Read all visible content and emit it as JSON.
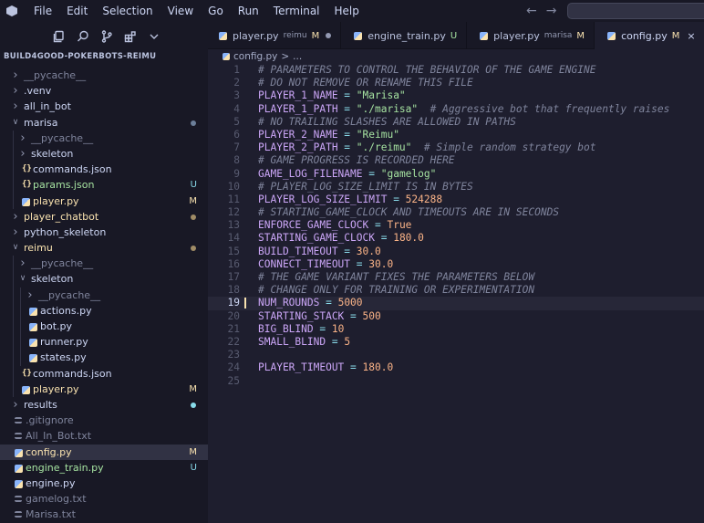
{
  "menu": [
    "File",
    "Edit",
    "Selection",
    "View",
    "Go",
    "Run",
    "Terminal",
    "Help"
  ],
  "icons": {
    "app": "vscode-logo-icon",
    "back": "arrow-left-icon",
    "forward": "arrow-right-icon",
    "explorer": "files-icon",
    "search": "search-icon",
    "scm": "source-control-icon",
    "extensions": "extensions-icon",
    "more": "chevron-down-icon"
  },
  "colors": {
    "background": "#1e1e2e",
    "sidebar": "#181825",
    "modified": "#f9e2af",
    "untracked": "#a6e3a1",
    "comment": "#7f849c",
    "variable": "#cba6f7",
    "string": "#a6e3a1",
    "number": "#fab387"
  },
  "explorer": {
    "title": "BUILD4GOOD-POKERBOTS-REIMU",
    "items": [
      {
        "label": "__pycache__",
        "type": "folder",
        "open": false,
        "depth": 0,
        "state": "dim"
      },
      {
        "label": ".venv",
        "type": "folder",
        "open": false,
        "depth": 0,
        "state": "normal"
      },
      {
        "label": "all_in_bot",
        "type": "folder",
        "open": false,
        "depth": 0,
        "state": "normal"
      },
      {
        "label": "marisa",
        "type": "folder",
        "open": true,
        "depth": 0,
        "state": "normal",
        "dot": true
      },
      {
        "label": "__pycache__",
        "type": "folder",
        "open": false,
        "depth": 1,
        "state": "dim"
      },
      {
        "label": "skeleton",
        "type": "folder",
        "open": false,
        "depth": 1,
        "state": "normal"
      },
      {
        "label": "commands.json",
        "type": "json",
        "depth": 1,
        "state": "normal"
      },
      {
        "label": "params.json",
        "type": "json",
        "depth": 1,
        "state": "untracked",
        "badge": "U"
      },
      {
        "label": "player.py",
        "type": "py",
        "depth": 1,
        "state": "mod",
        "badge": "M"
      },
      {
        "label": "player_chatbot",
        "type": "folder",
        "open": false,
        "depth": 0,
        "state": "mod",
        "dot": true
      },
      {
        "label": "python_skeleton",
        "type": "folder",
        "open": false,
        "depth": 0,
        "state": "normal"
      },
      {
        "label": "reimu",
        "type": "folder",
        "open": true,
        "depth": 0,
        "state": "mod",
        "dot": true
      },
      {
        "label": "__pycache__",
        "type": "folder",
        "open": false,
        "depth": 1,
        "state": "dim"
      },
      {
        "label": "skeleton",
        "type": "folder",
        "open": true,
        "depth": 1,
        "state": "normal"
      },
      {
        "label": "__pycache__",
        "type": "folder",
        "open": false,
        "depth": 2,
        "state": "dim"
      },
      {
        "label": "actions.py",
        "type": "py",
        "depth": 2,
        "state": "normal"
      },
      {
        "label": "bot.py",
        "type": "py",
        "depth": 2,
        "state": "normal"
      },
      {
        "label": "runner.py",
        "type": "py",
        "depth": 2,
        "state": "normal"
      },
      {
        "label": "states.py",
        "type": "py",
        "depth": 2,
        "state": "normal"
      },
      {
        "label": "commands.json",
        "type": "json",
        "depth": 1,
        "state": "normal"
      },
      {
        "label": "player.py",
        "type": "py",
        "depth": 1,
        "state": "mod",
        "badge": "M"
      },
      {
        "label": "results",
        "type": "folder",
        "open": false,
        "depth": 0,
        "state": "normal",
        "dot": true,
        "dotColor": "#89dceb"
      },
      {
        "label": ".gitignore",
        "type": "txt",
        "depth": 0,
        "state": "dim"
      },
      {
        "label": "All_In_Bot.txt",
        "type": "txt",
        "depth": 0,
        "state": "dim"
      },
      {
        "label": "config.py",
        "type": "py",
        "depth": 0,
        "state": "mod",
        "badge": "M",
        "selected": true
      },
      {
        "label": "engine_train.py",
        "type": "py",
        "depth": 0,
        "state": "untracked",
        "badge": "U"
      },
      {
        "label": "engine.py",
        "type": "py",
        "depth": 0,
        "state": "normal"
      },
      {
        "label": "gamelog.txt",
        "type": "txt",
        "depth": 0,
        "state": "dim"
      },
      {
        "label": "Marisa.txt",
        "type": "txt",
        "depth": 0,
        "state": "dim"
      }
    ]
  },
  "tabs": [
    {
      "label": "player.py",
      "desc": "reimu",
      "badge": "M",
      "badgeType": "mod",
      "dirty": true,
      "active": false
    },
    {
      "label": "engine_train.py",
      "desc": "",
      "badge": "U",
      "badgeType": "untracked",
      "dirty": false,
      "active": false
    },
    {
      "label": "player.py",
      "desc": "marisa",
      "badge": "M",
      "badgeType": "mod",
      "dirty": false,
      "active": false
    },
    {
      "label": "config.py",
      "desc": "",
      "badge": "M",
      "badgeType": "mod",
      "dirty": false,
      "active": true,
      "close": "×"
    }
  ],
  "breadcrumb": {
    "file": "config.py",
    "sep": ">",
    "rest": "..."
  },
  "editor": {
    "current_line": 19,
    "lines": [
      [
        [
          "c",
          "# PARAMETERS TO CONTROL THE BEHAVIOR OF THE GAME ENGINE"
        ]
      ],
      [
        [
          "c",
          "# DO NOT REMOVE OR RENAME THIS FILE"
        ]
      ],
      [
        [
          "v",
          "PLAYER_1_NAME"
        ],
        [
          "o",
          " = "
        ],
        [
          "s",
          "\"Marisa\""
        ]
      ],
      [
        [
          "v",
          "PLAYER_1_PATH"
        ],
        [
          "o",
          " = "
        ],
        [
          "s",
          "\"./marisa\""
        ],
        [
          "p",
          "  "
        ],
        [
          "c",
          "# Aggressive bot that frequently raises"
        ]
      ],
      [
        [
          "c",
          "# NO TRAILING SLASHES ARE ALLOWED IN PATHS"
        ]
      ],
      [
        [
          "v",
          "PLAYER_2_NAME"
        ],
        [
          "o",
          " = "
        ],
        [
          "s",
          "\"Reimu\""
        ]
      ],
      [
        [
          "v",
          "PLAYER_2_PATH"
        ],
        [
          "o",
          " = "
        ],
        [
          "s",
          "\"./reimu\""
        ],
        [
          "p",
          "  "
        ],
        [
          "c",
          "# Simple random strategy bot"
        ]
      ],
      [
        [
          "c",
          "# GAME PROGRESS IS RECORDED HERE"
        ]
      ],
      [
        [
          "v",
          "GAME_LOG_FILENAME"
        ],
        [
          "o",
          " = "
        ],
        [
          "s",
          "\"gamelog\""
        ]
      ],
      [
        [
          "c",
          "# PLAYER_LOG_SIZE_LIMIT IS IN BYTES"
        ]
      ],
      [
        [
          "v",
          "PLAYER_LOG_SIZE_LIMIT"
        ],
        [
          "o",
          " = "
        ],
        [
          "n",
          "524288"
        ]
      ],
      [
        [
          "c",
          "# STARTING_GAME_CLOCK AND TIMEOUTS ARE IN SECONDS"
        ]
      ],
      [
        [
          "v",
          "ENFORCE_GAME_CLOCK"
        ],
        [
          "o",
          " = "
        ],
        [
          "k",
          "True"
        ]
      ],
      [
        [
          "v",
          "STARTING_GAME_CLOCK"
        ],
        [
          "o",
          " = "
        ],
        [
          "n",
          "180.0"
        ]
      ],
      [
        [
          "v",
          "BUILD_TIMEOUT"
        ],
        [
          "o",
          " = "
        ],
        [
          "n",
          "30.0"
        ]
      ],
      [
        [
          "v",
          "CONNECT_TIMEOUT"
        ],
        [
          "o",
          " = "
        ],
        [
          "n",
          "30.0"
        ]
      ],
      [
        [
          "c",
          "# THE GAME VARIANT FIXES THE PARAMETERS BELOW"
        ]
      ],
      [
        [
          "c",
          "# CHANGE ONLY FOR TRAINING OR EXPERIMENTATION"
        ]
      ],
      [
        [
          "v",
          "NUM_ROUNDS"
        ],
        [
          "o",
          " = "
        ],
        [
          "n",
          "5000"
        ]
      ],
      [
        [
          "v",
          "STARTING_STACK"
        ],
        [
          "o",
          " = "
        ],
        [
          "n",
          "500"
        ]
      ],
      [
        [
          "v",
          "BIG_BLIND"
        ],
        [
          "o",
          " = "
        ],
        [
          "n",
          "10"
        ]
      ],
      [
        [
          "v",
          "SMALL_BLIND"
        ],
        [
          "o",
          " = "
        ],
        [
          "n",
          "5"
        ]
      ],
      [],
      [
        [
          "v",
          "PLAYER_TIMEOUT"
        ],
        [
          "o",
          " = "
        ],
        [
          "n",
          "180.0"
        ]
      ],
      []
    ]
  }
}
